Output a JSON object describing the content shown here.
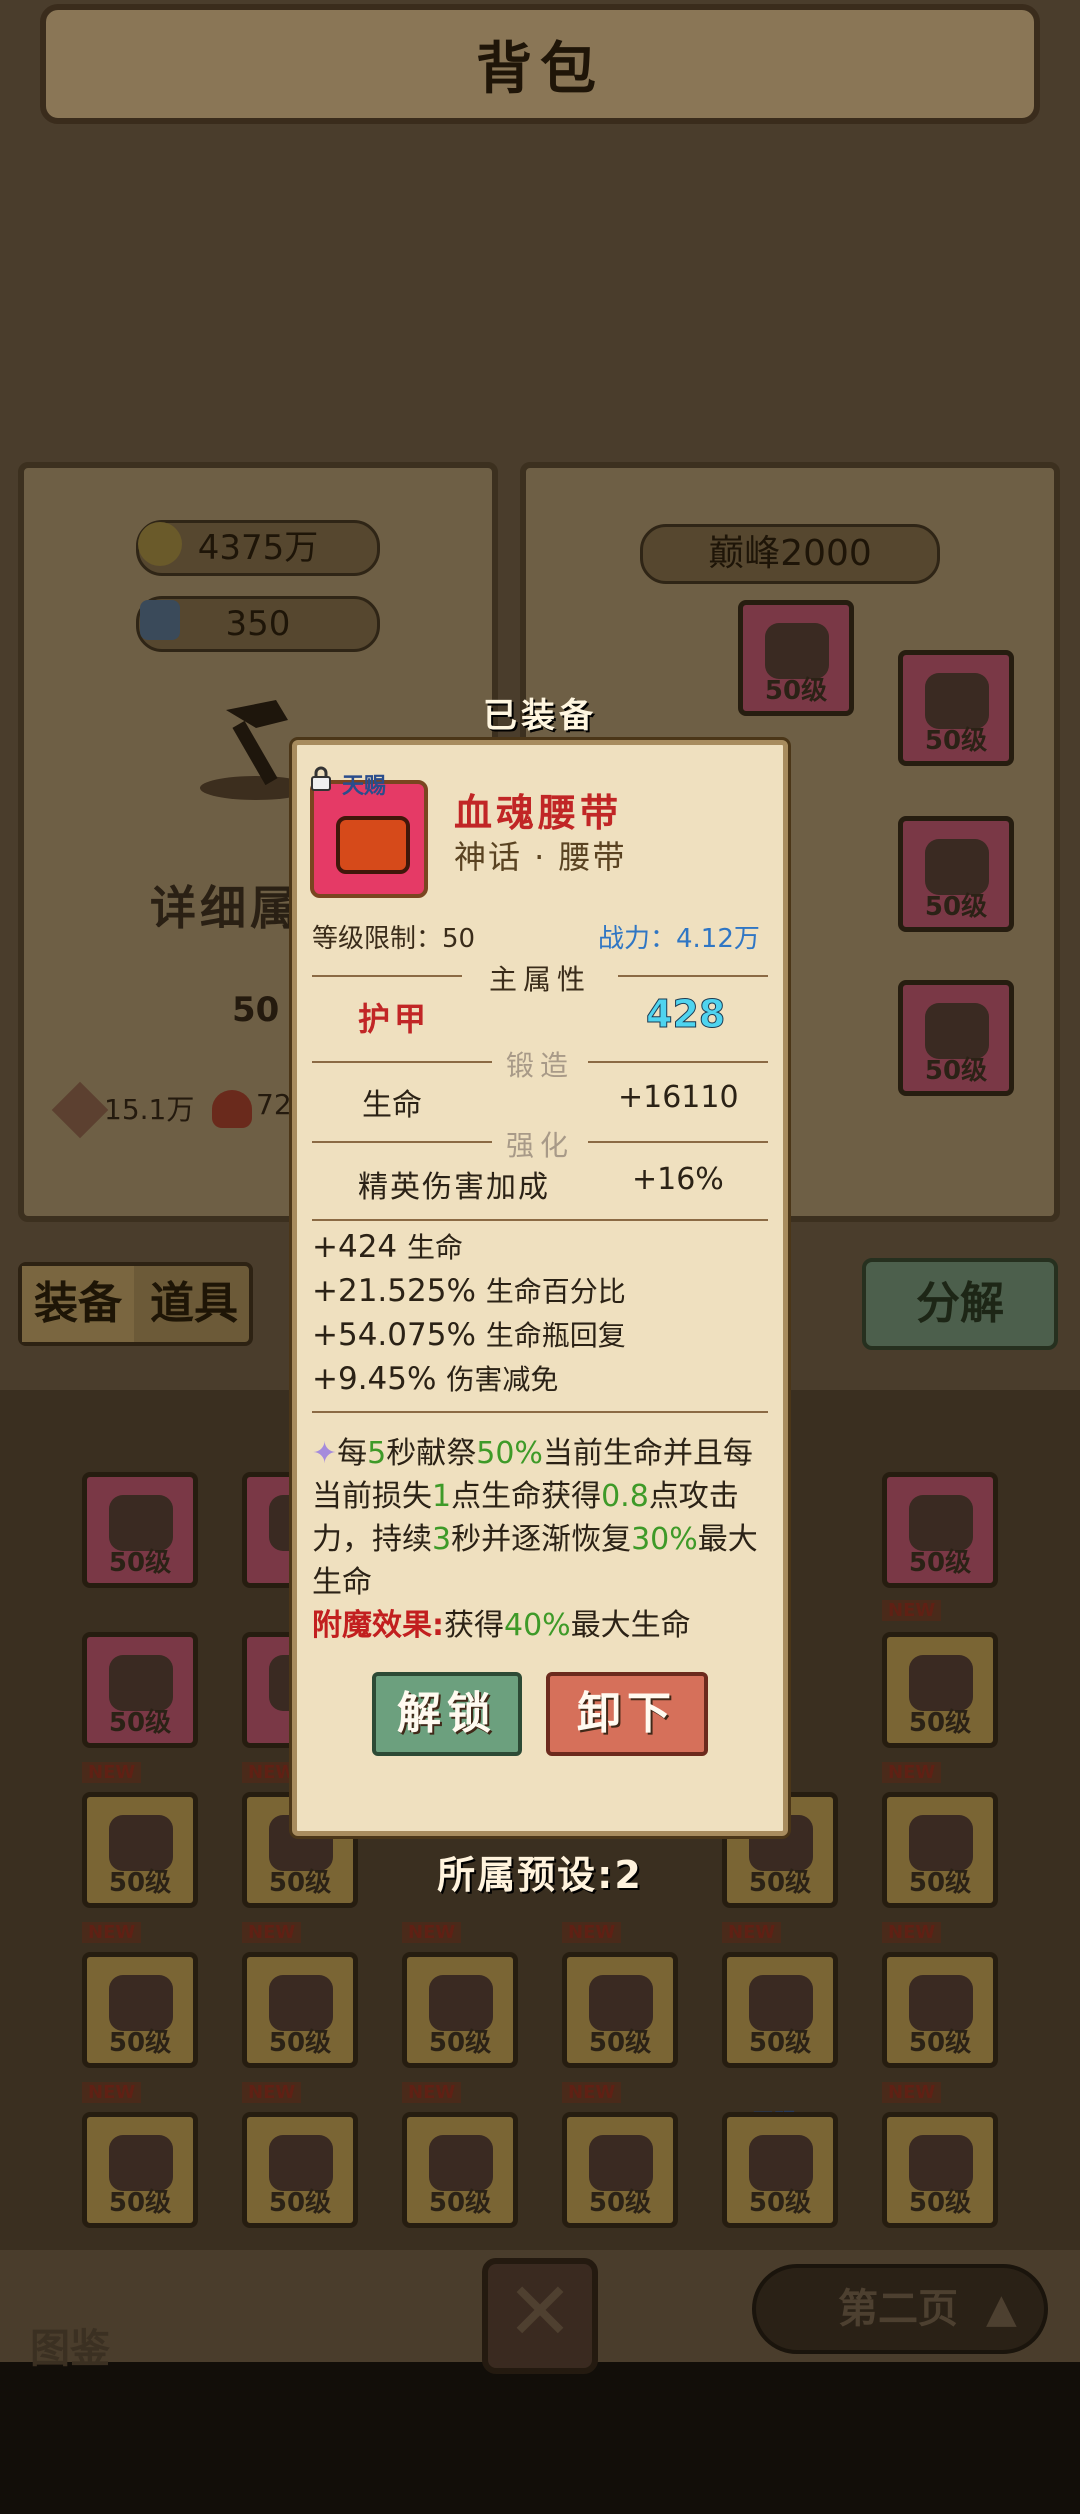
{
  "header": {
    "title": "背包"
  },
  "left_panel": {
    "gold_amount": "4375万",
    "gem_amount": "350",
    "detail_label": "详细属",
    "level_value": "50",
    "attack_value": "15.1万",
    "hp_value": "72"
  },
  "right_panel": {
    "peak_label": "巅峰2000"
  },
  "tabs": {
    "equip": "装备",
    "props": "道具"
  },
  "decompose_label": "分解",
  "grid": {
    "level_label": "50级",
    "new_label": "NEW",
    "gift_label": "天赐"
  },
  "bottom": {
    "atlas_label": "图鉴",
    "page_label": "第二页"
  },
  "popup": {
    "equipped_title": "已装备",
    "gift_tag": "天赐",
    "item_name": "血魂腰带",
    "item_type": "神话 · 腰带",
    "level_req": "等级限制：50",
    "power": "战力：4.12万",
    "main_attr_title": "主属性",
    "main_attr_name": "护甲",
    "main_attr_value": "428",
    "forge_title": "锻造",
    "forge_name": "生命",
    "forge_value": "+16110",
    "enhance_title": "强化",
    "enhance_name": "精英伤害加成",
    "enhance_value": "+16%",
    "stats": [
      {
        "value": "+424",
        "name": "生命"
      },
      {
        "value": "+21.525%",
        "name": "生命百分比"
      },
      {
        "value": "+54.075%",
        "name": "生命瓶回复"
      },
      {
        "value": "+9.45%",
        "name": "伤害减免"
      }
    ],
    "skill": {
      "p1": "每",
      "n1": "5",
      "p2": "秒献祭",
      "n2": "50%",
      "p3": "当前生命并且每当前损失",
      "n3": "1",
      "p4": "点生命获得",
      "n4": "0.8",
      "p5": "点攻击力，持续",
      "n5": "3",
      "p6": "秒并逐渐恢复",
      "n6": "30%",
      "p7": "最大生命"
    },
    "enchant_label": "附魔效果:",
    "enchant_p1": "获得",
    "enchant_n1": "40%",
    "enchant_p2": "最大生命",
    "unlock_button": "解锁",
    "unequip_button": "卸下",
    "preset_label": "所属预设:2"
  },
  "colors": {
    "accent_red": "#c12626",
    "accent_green": "#3e9a28",
    "power_blue": "#2f76c4"
  }
}
